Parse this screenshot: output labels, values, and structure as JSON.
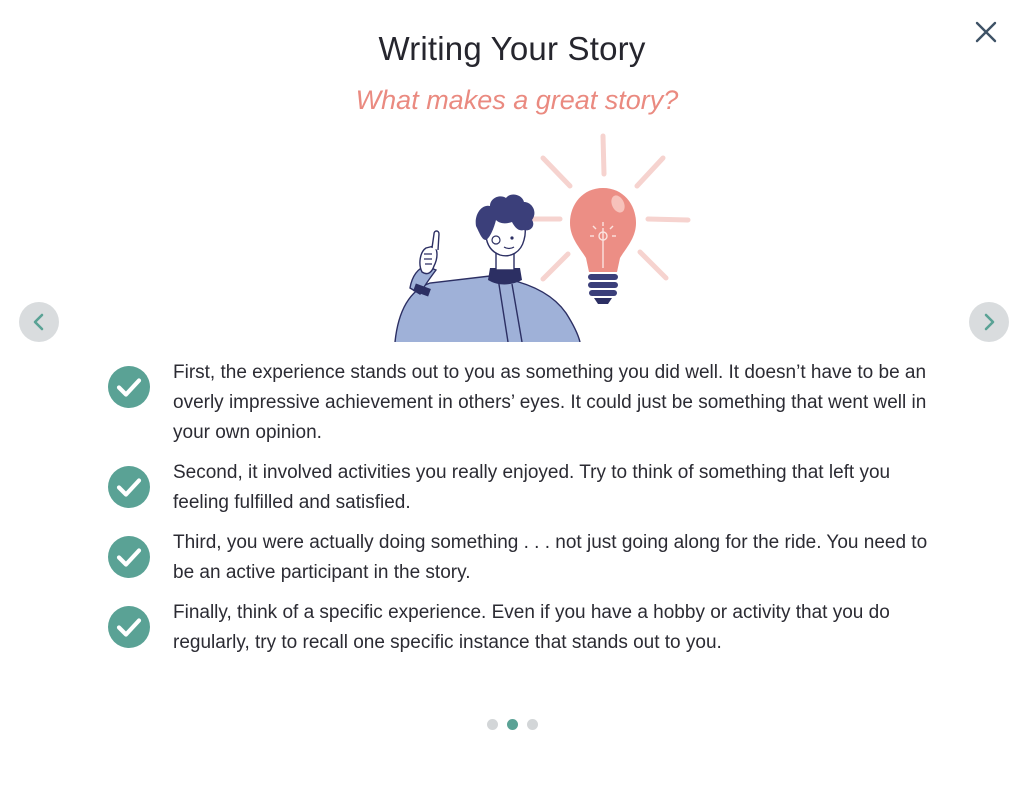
{
  "dialog": {
    "title": "Writing Your Story",
    "subtitle": "What makes a great story?"
  },
  "items": [
    {
      "text": "First, the experience stands out to you as something you did well. It doesn’t have to be an overly impressive achievement in others’ eyes. It could just be something that went well in your own opinion."
    },
    {
      "text": "Second, it involved activities you really enjoyed. Try to think of something that left you feeling fulfilled and satisfied."
    },
    {
      "text": "Third, you were actually doing something . . . not just going along for the ride. You need to be an active participant in the story."
    },
    {
      "text": "Finally, think of a specific experience. Even if you have a hobby or activity that you do regularly, try to recall one specific instance that stands out to you."
    }
  ],
  "pagination": {
    "total": 3,
    "current": 2
  },
  "icons": {
    "close": "close-icon",
    "prev": "chevron-left-icon",
    "next": "chevron-right-icon",
    "check": "check-circle-icon"
  },
  "colors": {
    "accent": "#5aa295",
    "subtitle": "#ea8a80",
    "title": "#26262e",
    "nav_bg": "#d9dcde",
    "dot_inactive": "#d3d6d8"
  }
}
